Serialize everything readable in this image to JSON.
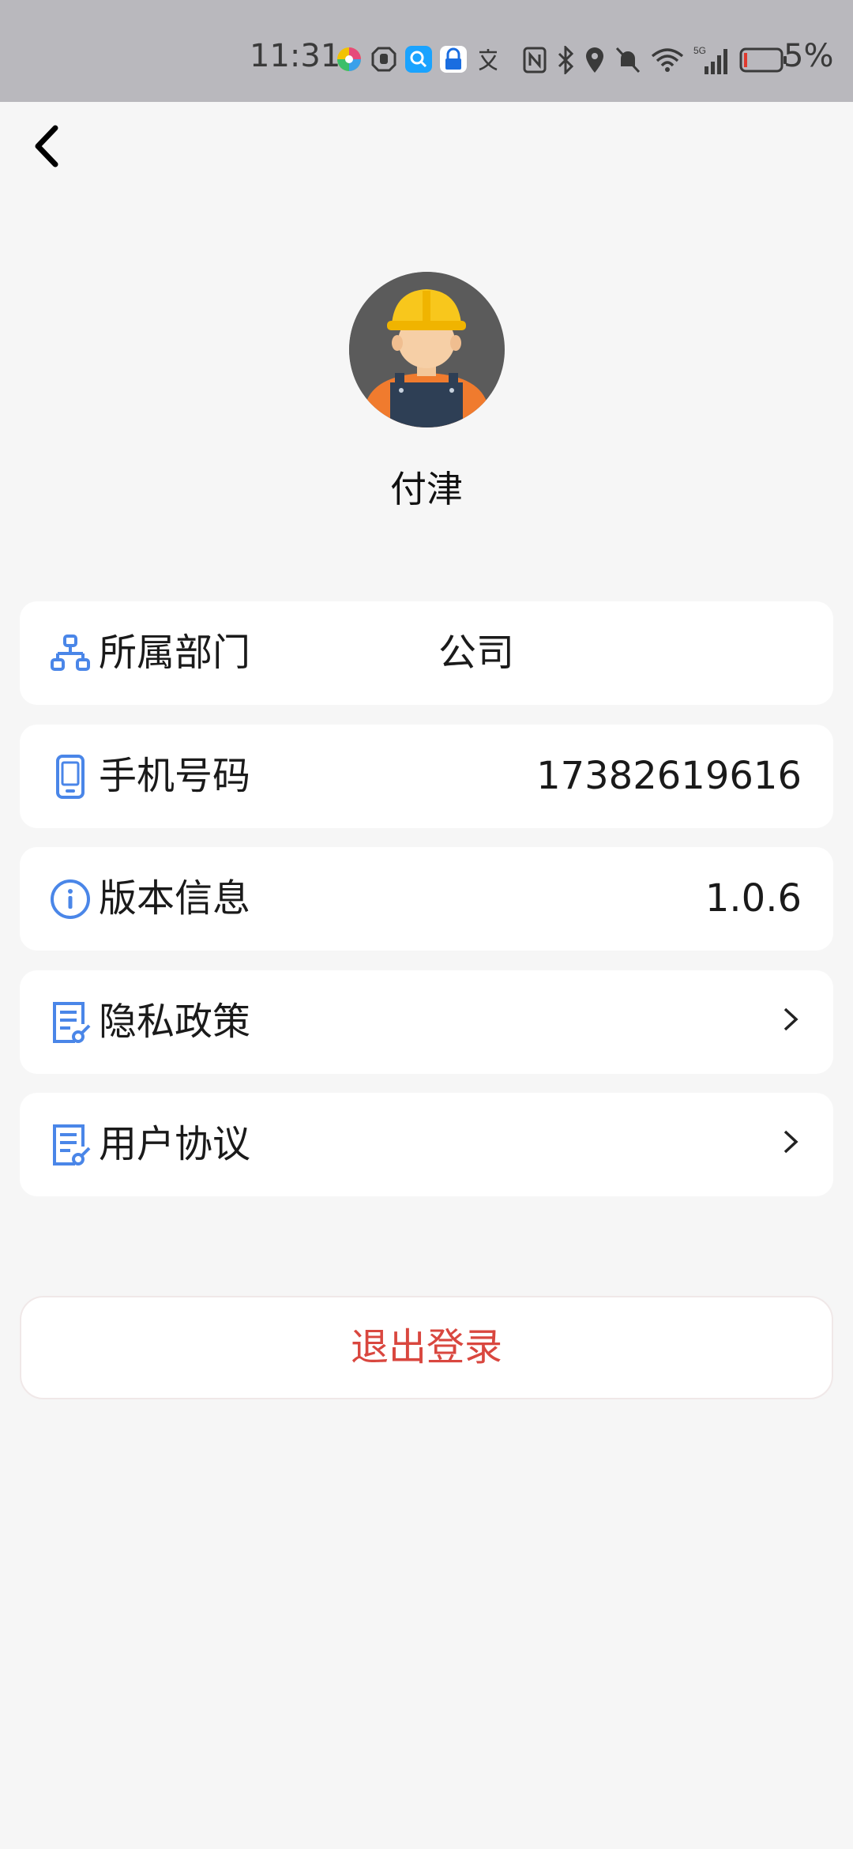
{
  "status_bar": {
    "time": "11:31",
    "battery_percent": "5%",
    "icons": [
      "color-wheel-app-icon",
      "hand-icon",
      "search-app-icon",
      "lock-app-icon",
      "translate-icon",
      "nfc-icon",
      "bluetooth-icon",
      "location-icon",
      "mute-icon",
      "wifi-icon",
      "signal-5g-icon",
      "battery-icon"
    ]
  },
  "profile": {
    "name": "付津",
    "avatar": "worker-avatar"
  },
  "rows": [
    {
      "label": "所属部门",
      "value": "公司",
      "icon": "org-chart-icon"
    },
    {
      "label": "手机号码",
      "value": "17382619616",
      "icon": "phone-icon"
    },
    {
      "label": "版本信息",
      "value": "1.0.6",
      "icon": "info-icon"
    },
    {
      "label": "隐私政策",
      "value": "",
      "icon": "document-edit-icon"
    },
    {
      "label": "用户协议",
      "value": "",
      "icon": "document-edit-icon"
    }
  ],
  "logout_label": "退出登录",
  "colors": {
    "accent_blue": "#4a86e8",
    "logout_red": "#d9473f",
    "background": "#f6f6f6"
  }
}
